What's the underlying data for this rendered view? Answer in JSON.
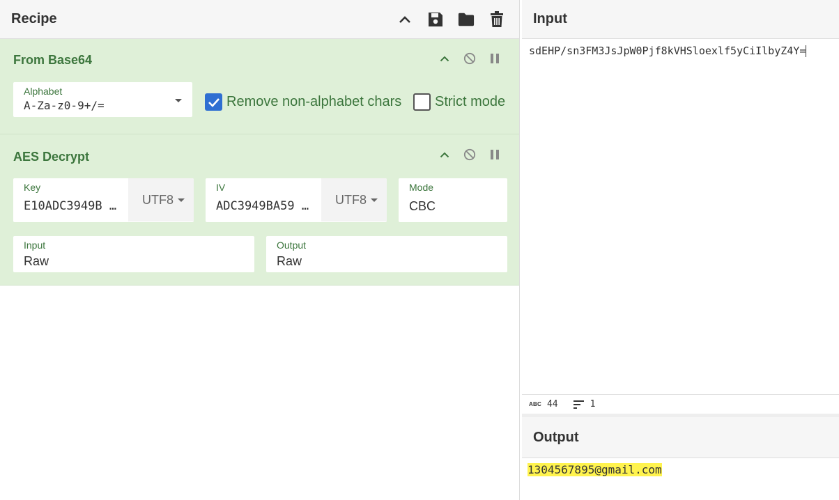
{
  "recipe": {
    "title": "Recipe",
    "header_icons": [
      "chevron-up-icon",
      "save-icon",
      "folder-icon",
      "trash-icon"
    ]
  },
  "operations": {
    "from_base64": {
      "title": "From Base64",
      "alphabet_label": "Alphabet",
      "alphabet_value": "A-Za-z0-9+/=",
      "remove_non_alphabet_label": "Remove non-alphabet chars",
      "remove_non_alphabet_checked": true,
      "strict_mode_label": "Strict mode",
      "strict_mode_checked": false
    },
    "aes_decrypt": {
      "title": "AES Decrypt",
      "key_label": "Key",
      "key_value": "E10ADC3949B …",
      "key_encoding": "UTF8",
      "iv_label": "IV",
      "iv_value": "ADC3949BA59 …",
      "iv_encoding": "UTF8",
      "mode_label": "Mode",
      "mode_value": "CBC",
      "input_label": "Input",
      "input_value": "Raw",
      "output_label": "Output",
      "output_value": "Raw"
    }
  },
  "input_pane": {
    "title": "Input",
    "text": "sdEHP/sn3FM3JsJpW0Pjf8kVHSloexlf5yCiIlbyZ4Y=",
    "status": {
      "length_icon_label": "ABC",
      "length": "44",
      "lines": "1"
    }
  },
  "output_pane": {
    "title": "Output",
    "text": "1304567895@gmail.com"
  },
  "colors": {
    "operation_bg": "#dff0d8",
    "operation_title": "#3c763d",
    "checkbox_checked": "#2f6fd2",
    "output_highlight": "#fff34e"
  }
}
